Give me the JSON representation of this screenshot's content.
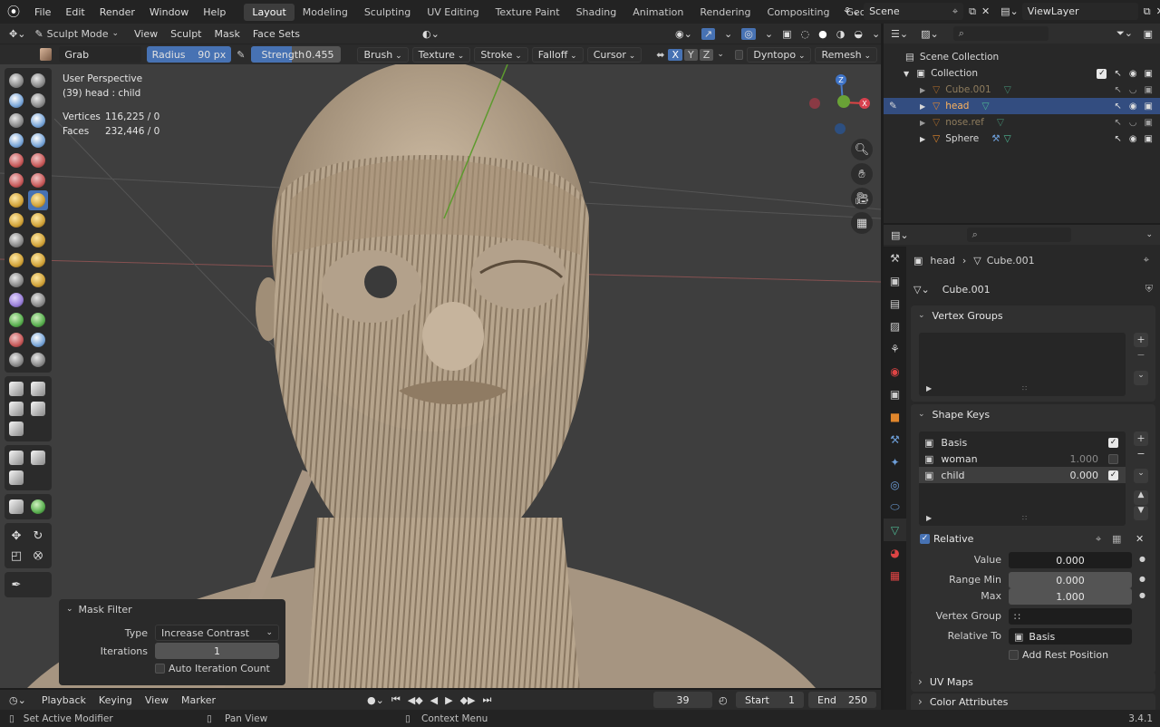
{
  "topbar": {
    "menus": [
      "File",
      "Edit",
      "Render",
      "Window",
      "Help"
    ],
    "workspaces": [
      "Layout",
      "Modeling",
      "Sculpting",
      "UV Editing",
      "Texture Paint",
      "Shading",
      "Animation",
      "Rendering",
      "Compositing",
      "Geometry Nodes"
    ],
    "active_workspace": "Layout",
    "scene": "Scene",
    "view_layer": "ViewLayer"
  },
  "viewport_header": {
    "mode": "Sculpt Mode",
    "menus": [
      "View",
      "Sculpt",
      "Mask",
      "Face Sets"
    ]
  },
  "tool_header": {
    "brush_name": "Grab",
    "radius_label": "Radius",
    "radius_value": "90 px",
    "strength_label": "Strength",
    "strength_value": "0.455",
    "strength_fraction": 0.455,
    "dropdowns": [
      "Brush",
      "Texture",
      "Stroke",
      "Falloff",
      "Cursor"
    ],
    "axes": [
      "X",
      "Y",
      "Z"
    ],
    "dyntopo": "Dyntopo",
    "remesh": "Remesh"
  },
  "overlay": {
    "perspective": "User Perspective",
    "object": "(39) head : child",
    "vertices_label": "Vertices",
    "vertices_value": "116,225 / 0",
    "faces_label": "Faces",
    "faces_value": "232,446 / 0"
  },
  "mask_filter": {
    "title": "Mask Filter",
    "type_label": "Type",
    "type_value": "Increase Contrast",
    "iterations_label": "Iterations",
    "iterations_value": "1",
    "auto_label": "Auto Iteration Count"
  },
  "timeline": {
    "menus": [
      "Playback",
      "Keying",
      "View",
      "Marker"
    ],
    "current_frame": "39",
    "start_label": "Start",
    "start_value": "1",
    "end_label": "End",
    "end_value": "250"
  },
  "statusbar": {
    "left": "Set Active Modifier",
    "middle": "Pan View",
    "right": "Context Menu",
    "version": "3.4.1"
  },
  "outliner": {
    "scene_collection": "Scene Collection",
    "collection": "Collection",
    "items": [
      {
        "name": "Cube.001",
        "dim": true
      },
      {
        "name": "head",
        "selected": true
      },
      {
        "name": "nose.ref",
        "dim": true
      },
      {
        "name": "Sphere",
        "dim": false
      }
    ]
  },
  "properties": {
    "breadcrumb_object": "head",
    "breadcrumb_data": "Cube.001",
    "mesh_name": "Cube.001",
    "vertex_groups_title": "Vertex Groups",
    "shape_keys_title": "Shape Keys",
    "shape_keys": [
      {
        "name": "Basis",
        "value": "",
        "checked": true
      },
      {
        "name": "woman",
        "value": "1.000",
        "checked": false
      },
      {
        "name": "child",
        "value": "0.000",
        "checked": true
      }
    ],
    "relative_label": "Relative",
    "value_label": "Value",
    "value_value": "0.000",
    "range_min_label": "Range Min",
    "range_min_value": "0.000",
    "max_label": "Max",
    "max_value": "1.000",
    "vertex_group_label": "Vertex Group",
    "relative_to_label": "Relative To",
    "relative_to_value": "Basis",
    "add_rest_label": "Add Rest Position",
    "uv_maps_title": "UV Maps",
    "color_attributes_title": "Color Attributes"
  },
  "colors": {
    "accent": "#4772b3",
    "selected_row": "#334d80",
    "viewport_bg": "#3e3e3e",
    "mesh": "#b19f87",
    "object_orange": "#e0862c",
    "mesh_green": "#4fb894"
  }
}
